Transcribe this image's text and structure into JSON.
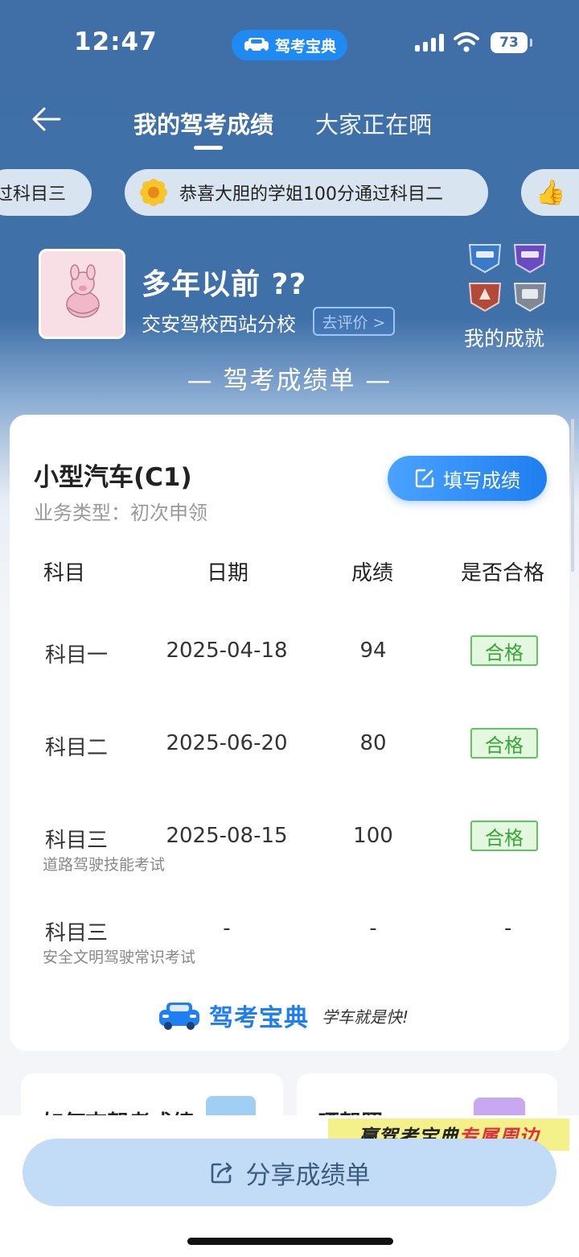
{
  "status": {
    "time": "12:47",
    "app_name": "驾考宝典",
    "battery": "73"
  },
  "nav": {
    "tabs": [
      "我的驾考成绩",
      "大家正在晒"
    ]
  },
  "ticker": [
    "过科目三",
    "恭喜大胆的学姐100分通过科目二",
    "👍"
  ],
  "profile": {
    "name": "多年以前 ??",
    "school": "交安驾校西站分校",
    "rate_label": "去评价 >",
    "achievements_label": "我的成就"
  },
  "section_title": "— 驾考成绩单 —",
  "card": {
    "license": "小型汽车(C1)",
    "business_type": "业务类型：初次申领",
    "fill_button": "填写成绩",
    "headers": [
      "科目",
      "日期",
      "成绩",
      "是否合格"
    ],
    "rows": [
      {
        "subject": "科目一",
        "note": "",
        "date": "2025-04-18",
        "score": "94",
        "pass": "合格"
      },
      {
        "subject": "科目二",
        "note": "",
        "date": "2025-06-20",
        "score": "80",
        "pass": "合格"
      },
      {
        "subject": "科目三",
        "note": "道路驾驶技能考试",
        "date": "2025-08-15",
        "score": "100",
        "pass": "合格"
      },
      {
        "subject": "科目三",
        "note": "安全文明驾驶常识考试",
        "date": "-",
        "score": "-",
        "pass": "-"
      }
    ],
    "brand_name": "驾考宝典",
    "brand_slogan": "学车就是快!"
  },
  "bottom": {
    "left_card": "如何查驾考成绩",
    "right_card": "晒驾照",
    "promo_a": "赢驾考宝典",
    "promo_b": "专属周边",
    "share_button": "分享成绩单"
  },
  "colors": {
    "header_blue": "#3f6fa6",
    "accent_blue": "#1f7ef0",
    "pass_green": "#3aa63a"
  }
}
